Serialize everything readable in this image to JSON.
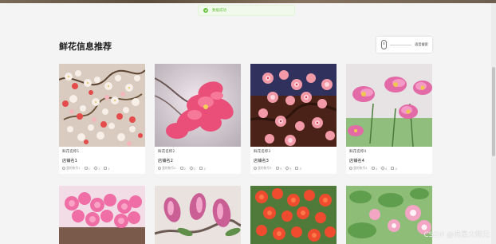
{
  "toast": {
    "message": "数据成功"
  },
  "page": {
    "title": "鲜花信息推荐"
  },
  "voice": {
    "label": "语音搜索"
  },
  "cards": [
    {
      "name": "鲜花名称1",
      "shop": "店铺名1",
      "user": "我的账号1",
      "likes": "1",
      "favorites": "1",
      "comments": "1"
    },
    {
      "name": "鲜花名称2",
      "shop": "店铺名2",
      "user": "我的账号2",
      "likes": "2",
      "favorites": "2",
      "comments": "2"
    },
    {
      "name": "鲜花名称3",
      "shop": "店铺名3",
      "user": "我的账号3",
      "likes": "3",
      "favorites": "3",
      "comments": "3"
    },
    {
      "name": "鲜花名称4",
      "shop": "店铺名4",
      "user": "我的账号4",
      "likes": "4",
      "favorites": "4",
      "comments": "4"
    }
  ],
  "watermark": "CSDN @伟是大师兄",
  "colors": {
    "success": "#67c23a",
    "background": "#f4f4f4",
    "card": "#ffffff"
  }
}
